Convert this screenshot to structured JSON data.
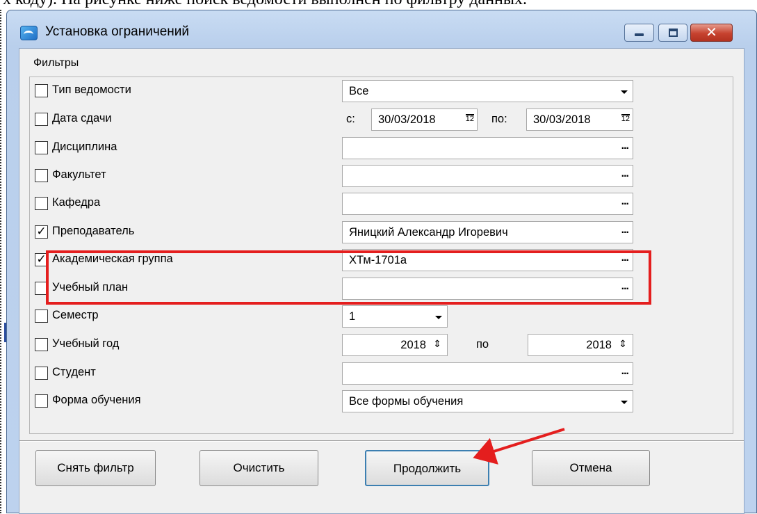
{
  "caption": "х коду). На рисунке ниже поиск ведомости выполнен по фильтру данных.",
  "window": {
    "title": "Установка ограничений",
    "controls": {
      "minimize": "minimize",
      "maximize": "maximize",
      "close": "✕"
    }
  },
  "filters_group_label": "Фильтры",
  "filters": [
    {
      "label": "Тип ведомости",
      "checked": false,
      "value": "Все",
      "control": "dropdown"
    },
    {
      "label": "Дата сдачи",
      "checked": false,
      "from_label": "с:",
      "from_value": "30/03/2018",
      "to_label": "по:",
      "to_value": "30/03/2018",
      "control": "date-range"
    },
    {
      "label": "Дисциплина",
      "checked": false,
      "value": "",
      "control": "picker"
    },
    {
      "label": "Факультет",
      "checked": false,
      "value": "",
      "control": "picker"
    },
    {
      "label": "Кафедра",
      "checked": false,
      "value": "",
      "control": "picker"
    },
    {
      "label": "Преподаватель",
      "checked": true,
      "value": "Яницкий Александр Игоревич",
      "control": "picker"
    },
    {
      "label": "Академическая группа",
      "checked": true,
      "value": "ХТм-1701а",
      "control": "picker"
    },
    {
      "label": "Учебный план",
      "checked": false,
      "value": "",
      "control": "picker"
    },
    {
      "label": "Семестр",
      "checked": false,
      "value": "1",
      "control": "dropdown"
    },
    {
      "label": "Учебный год",
      "checked": false,
      "from_value": "2018",
      "to_label": "по",
      "to_value": "2018",
      "control": "year-range"
    },
    {
      "label": "Студент",
      "checked": false,
      "value": "",
      "control": "picker"
    },
    {
      "label": "Форма обучения",
      "checked": false,
      "value": "Все формы обучения",
      "control": "dropdown"
    }
  ],
  "glyphs": {
    "ellipsis": "...",
    "spin": "⇕",
    "calendar": "12",
    "check": "✓"
  },
  "buttons": {
    "clear_filter": "Снять фильтр",
    "reset": "Очистить",
    "continue": "Продолжить",
    "cancel": "Отмена"
  },
  "colors": {
    "highlight": "#e41e1e",
    "arrow": "#e41e1e"
  }
}
